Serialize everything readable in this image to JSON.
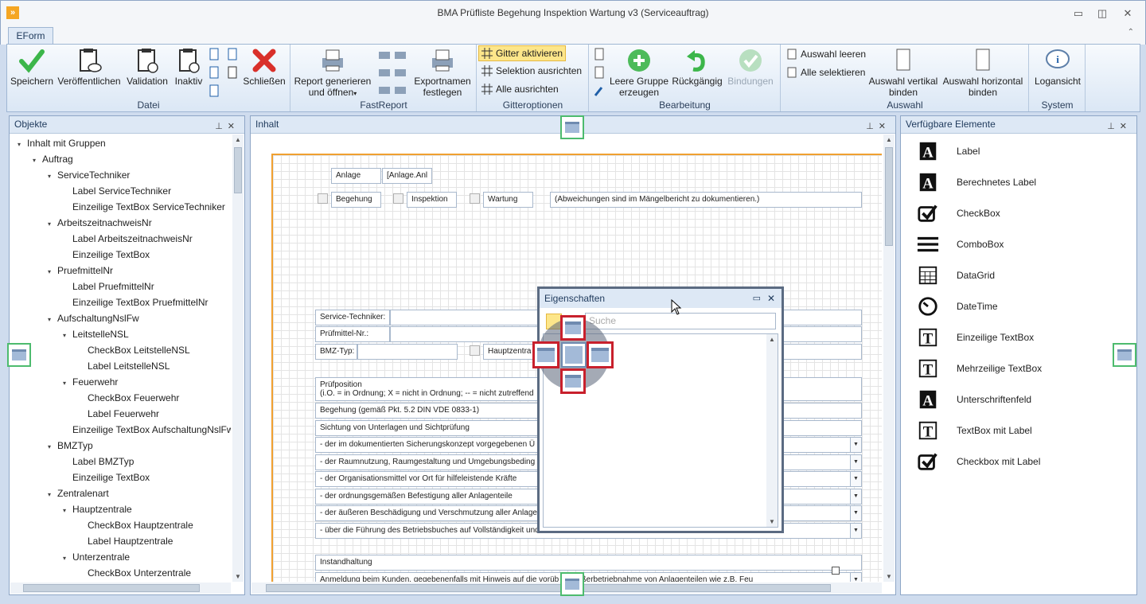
{
  "window": {
    "title": "BMA Prüfliste Begehung Inspektion Wartung v3 (Serviceauftrag)",
    "minimize": "▭",
    "restore": "◫",
    "close": "✕",
    "app_icon": "»"
  },
  "ribbon_tab": "EForm",
  "ribbon_collapse": "⌃",
  "groups": {
    "datei": {
      "label": "Datei",
      "buttons": [
        "Speichern",
        "Veröffentlichen",
        "Validation",
        "Inaktiv",
        "Schließen"
      ]
    },
    "fastreport": {
      "label": "FastReport",
      "report": [
        "Report generieren",
        "und öffnen"
      ],
      "export": [
        "Exportnamen",
        "festlegen"
      ]
    },
    "gitter": {
      "label": "Gitteroptionen",
      "items": [
        "Gitter aktivieren",
        "Selektion ausrichten",
        "Alle ausrichten"
      ]
    },
    "bearbeitung": {
      "label": "Bearbeitung",
      "leere": [
        "Leere Gruppe",
        "erzeugen"
      ],
      "rueck": "Rückgängig",
      "bind": "Bindungen"
    },
    "auswahl": {
      "label": "Auswahl",
      "items": [
        "Auswahl leeren",
        "Alle selektieren"
      ],
      "vert": [
        "Auswahl vertikal",
        "binden"
      ],
      "hor": [
        "Auswahl horizontal",
        "binden"
      ]
    },
    "system": {
      "label": "System",
      "log": "Logansicht"
    }
  },
  "objekte": {
    "title": "Objekte",
    "pin": "⊥",
    "close": "✕",
    "nodes": [
      {
        "t": "Inhalt mit Gruppen",
        "l": 0,
        "a": "▾"
      },
      {
        "t": "Auftrag",
        "l": 1,
        "a": "▾"
      },
      {
        "t": "ServiceTechniker",
        "l": 2,
        "a": "▾"
      },
      {
        "t": "Label ServiceTechniker",
        "l": 3,
        "a": ""
      },
      {
        "t": "Einzeilige TextBox ServiceTechniker",
        "l": 3,
        "a": ""
      },
      {
        "t": "ArbeitszeitnachweisNr",
        "l": 2,
        "a": "▾"
      },
      {
        "t": "Label ArbeitszeitnachweisNr",
        "l": 3,
        "a": ""
      },
      {
        "t": "Einzeilige TextBox",
        "l": 3,
        "a": ""
      },
      {
        "t": "PruefmittelNr",
        "l": 2,
        "a": "▾"
      },
      {
        "t": "Label PruefmittelNr",
        "l": 3,
        "a": ""
      },
      {
        "t": "Einzeilige TextBox PruefmittelNr",
        "l": 3,
        "a": ""
      },
      {
        "t": "AufschaltungNslFw",
        "l": 2,
        "a": "▾"
      },
      {
        "t": "LeitstelleNSL",
        "l": 3,
        "a": "▾"
      },
      {
        "t": "CheckBox LeitstelleNSL",
        "l": 4,
        "a": ""
      },
      {
        "t": "Label LeitstelleNSL",
        "l": 4,
        "a": ""
      },
      {
        "t": "Feuerwehr",
        "l": 3,
        "a": "▾"
      },
      {
        "t": "CheckBox Feuerwehr",
        "l": 4,
        "a": ""
      },
      {
        "t": "Label Feuerwehr",
        "l": 4,
        "a": ""
      },
      {
        "t": "Einzeilige TextBox AufschaltungNslFw",
        "l": 3,
        "a": ""
      },
      {
        "t": "BMZTyp",
        "l": 2,
        "a": "▾"
      },
      {
        "t": "Label BMZTyp",
        "l": 3,
        "a": ""
      },
      {
        "t": "Einzeilige TextBox",
        "l": 3,
        "a": ""
      },
      {
        "t": "Zentralenart",
        "l": 2,
        "a": "▾"
      },
      {
        "t": "Hauptzentrale",
        "l": 3,
        "a": "▾"
      },
      {
        "t": "CheckBox Hauptzentrale",
        "l": 4,
        "a": ""
      },
      {
        "t": "Label Hauptzentrale",
        "l": 4,
        "a": ""
      },
      {
        "t": "Unterzentrale",
        "l": 3,
        "a": "▾"
      },
      {
        "t": "CheckBox Unterzentrale",
        "l": 4,
        "a": ""
      }
    ]
  },
  "inhalt": {
    "title": "Inhalt",
    "pin": "⊥",
    "close": "✕",
    "form": {
      "anlage": "Anlage",
      "anlage_val": "[Anlage.Anl",
      "begehung": "Begehung",
      "inspektion": "Inspektion",
      "wartung": "Wartung",
      "abw": "(Abweichungen sind im Mängelbericht zu dokumentieren.)",
      "service": "Service-Techniker:",
      "pruefmittel": "Prüfmittel-Nr.:",
      "bmz": "BMZ-Typ:",
      "hauptz": "Hauptzentra",
      "pruefpos": "Prüfposition",
      "pruefpos2": "(i.O. = in Ordnung; X = nicht in Ordnung; -- = nicht zutreffend",
      "begehung_din": "Begehung (gemäß Pkt. 5.2 DIN VDE 0833-1)",
      "sichtung": "Sichtung von Unterlagen und Sichtprüfung",
      "rows": [
        "- der im dokumentierten Sicherungskonzept vorgegebenen Ü",
        "- der Raumnutzung, Raumgestaltung und Umgebungsbeding",
        "- der Organisationsmittel vor Ort für hilfeleistende Kräfte",
        "- der ordnungsgemäßen Befestigung aller Anlagenteile",
        "- der äußeren Beschädigung und Verschmutzung aller Anlage",
        "- über die Führung des Betriebsbuches auf Vollständigkeit und"
      ],
      "instand": "Instandhaltung",
      "anmeldung": "Anmeldung beim Kunden, gegebenenfalls mit Hinweis auf die vorüb             de Außerbetriebnahme von Anlagenteilen wie z.B. Feu"
    }
  },
  "eigenschaften": {
    "title": "Eigenschaften",
    "search_placeholder": "Suche",
    "restore": "▭",
    "close": "✕"
  },
  "elemente": {
    "title": "Verfügbare Elemente",
    "pin": "⊥",
    "close": "✕",
    "items": [
      {
        "label": "Label",
        "icon": "label-icon"
      },
      {
        "label": "Berechnetes Label",
        "icon": "calculated-label-icon"
      },
      {
        "label": "CheckBox",
        "icon": "checkbox-icon"
      },
      {
        "label": "ComboBox",
        "icon": "combobox-icon"
      },
      {
        "label": "DataGrid",
        "icon": "datagrid-icon"
      },
      {
        "label": "DateTime",
        "icon": "datetime-icon"
      },
      {
        "label": "Einzeilige TextBox",
        "icon": "textbox-icon"
      },
      {
        "label": "Mehrzeilige TextBox",
        "icon": "multiline-textbox-icon"
      },
      {
        "label": "Unterschriftenfeld",
        "icon": "signature-icon"
      },
      {
        "label": "TextBox mit Label",
        "icon": "textbox-label-icon"
      },
      {
        "label": "Checkbox mit Label",
        "icon": "checkbox-label-icon"
      }
    ]
  },
  "colors": {
    "accent_orange": "#f0a030",
    "dock_red": "#c8202c",
    "dock_green": "#4dbb6e",
    "highlight": "#fde68a"
  }
}
